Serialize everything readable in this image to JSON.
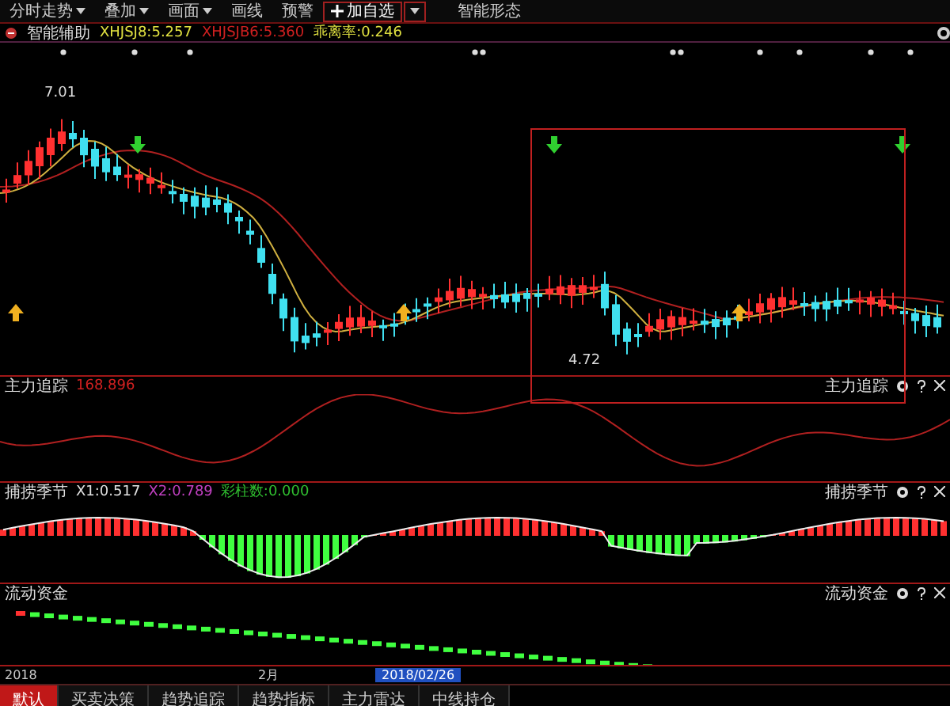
{
  "toolbar": {
    "menus": [
      {
        "label": "分时走势",
        "has_menu": true
      },
      {
        "label": "叠加",
        "has_menu": true
      },
      {
        "label": "画面",
        "has_menu": true
      },
      {
        "label": "画线",
        "has_menu": false
      },
      {
        "label": "预警",
        "has_menu": false
      }
    ],
    "add_watchlist": {
      "label": "加自选"
    },
    "pattern_button": {
      "label": "智能形态"
    }
  },
  "indicator_bar": {
    "title": "智能辅助",
    "values": [
      "XHJSJ8:5.257",
      "XHJSJB6:5.360",
      "乖离率:0.246"
    ]
  },
  "main_chart": {
    "high_label": "7.01",
    "low_label": "4.72"
  },
  "panels": [
    {
      "kind": "line",
      "title": "主力追踪",
      "right_title": "主力追踪",
      "values": [
        "168.896"
      ]
    },
    {
      "kind": "histogram",
      "title": "捕捞季节",
      "right_title": "捕捞季节",
      "values": [
        "X1:0.517",
        "X2:0.789",
        "彩柱数:0.000"
      ]
    },
    {
      "kind": "dots",
      "title": "流动资金",
      "right_title": "流动资金"
    }
  ],
  "time_axis": {
    "labels": [
      "2018",
      "2月"
    ],
    "current": "2018/02/26"
  },
  "tabs": [
    {
      "label": "默认",
      "selected": true
    },
    {
      "label": "买卖决策",
      "selected": false
    },
    {
      "label": "趋势追踪",
      "selected": false
    },
    {
      "label": "趋势指标",
      "selected": false
    },
    {
      "label": "主力雷达",
      "selected": false
    },
    {
      "label": "中线持仓",
      "selected": false
    }
  ]
}
